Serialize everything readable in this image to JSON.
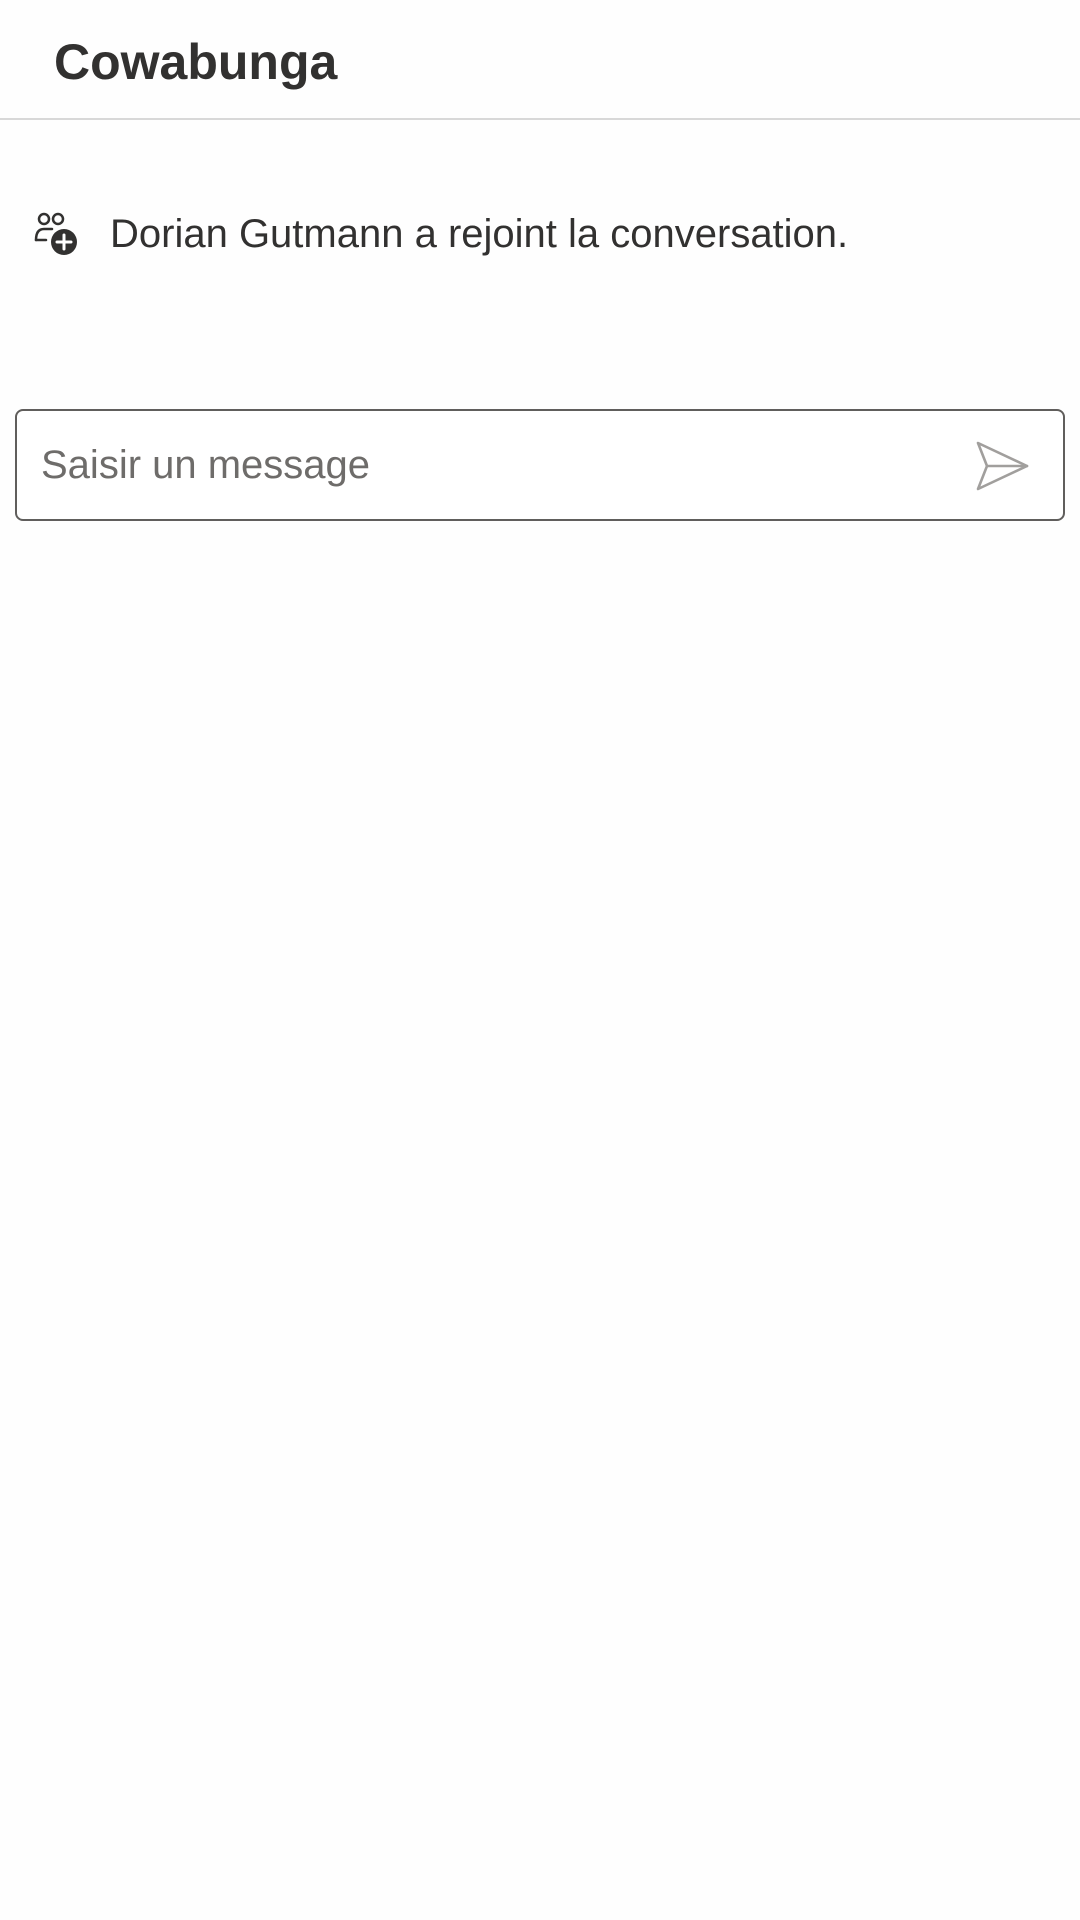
{
  "header": {
    "title": "Cowabunga"
  },
  "messages": [
    {
      "type": "system",
      "icon": "people-add-icon",
      "text": "Dorian Gutmann a rejoint la conversation."
    }
  ],
  "composer": {
    "placeholder": "Saisir un message",
    "value": "",
    "send_icon": "send-icon"
  },
  "colors": {
    "text": "#323130",
    "border": "#605e5c",
    "divider": "#d8d8d8",
    "send_icon": "#a19f9d",
    "background": "#fefefe"
  }
}
